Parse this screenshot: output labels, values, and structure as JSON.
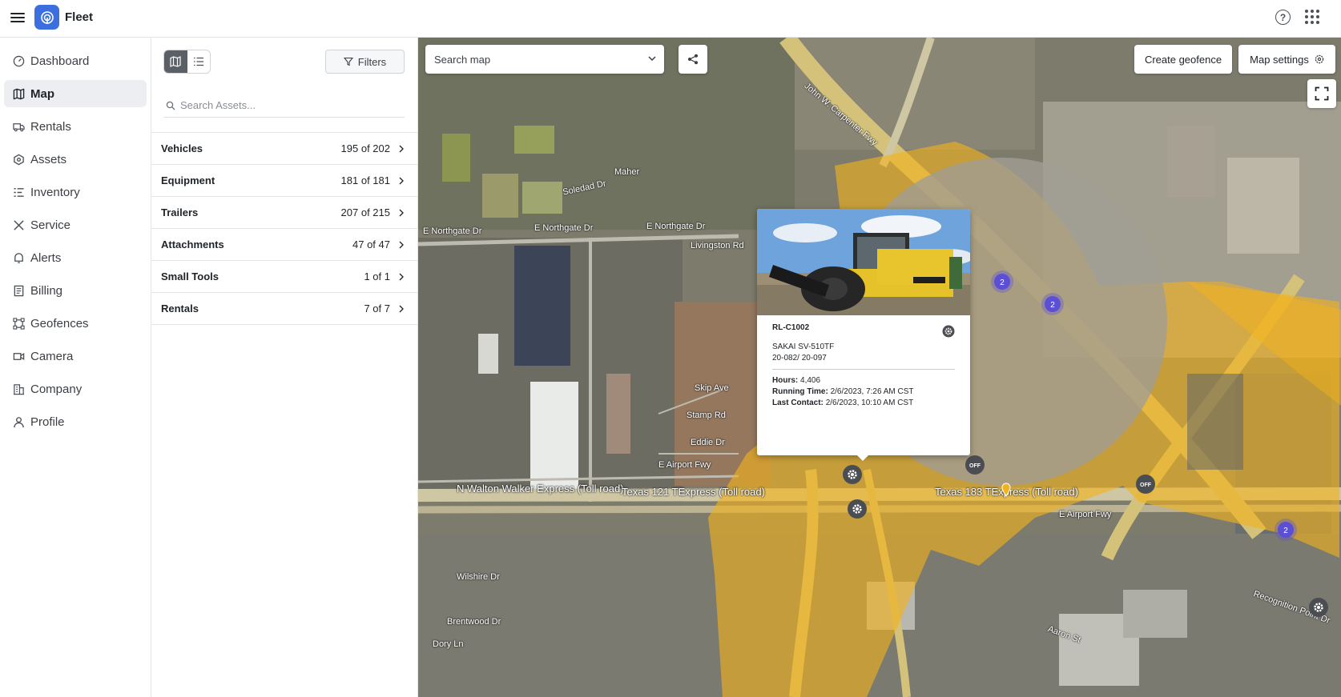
{
  "app": {
    "title": "Fleet",
    "menu_icon": "hamburger-menu-icon",
    "logo_icon": "fleet-logo-icon",
    "help_icon": "help-circle-icon",
    "apps_icon": "apps-grid-icon",
    "accent_color": "#3b6fe0"
  },
  "nav": {
    "items": [
      {
        "label": "Dashboard",
        "icon": "dashboard-icon"
      },
      {
        "label": "Map",
        "icon": "map-icon",
        "active": true
      },
      {
        "label": "Rentals",
        "icon": "truck-icon"
      },
      {
        "label": "Assets",
        "icon": "hexagon-icon"
      },
      {
        "label": "Inventory",
        "icon": "list-icon"
      },
      {
        "label": "Service",
        "icon": "wrench-icon"
      },
      {
        "label": "Alerts",
        "icon": "bell-icon"
      },
      {
        "label": "Billing",
        "icon": "invoice-icon"
      },
      {
        "label": "Geofences",
        "icon": "geofence-icon"
      },
      {
        "label": "Camera",
        "icon": "camera-icon"
      },
      {
        "label": "Company",
        "icon": "building-icon"
      },
      {
        "label": "Profile",
        "icon": "user-icon"
      }
    ]
  },
  "panel": {
    "filters_label": "Filters",
    "search_placeholder": "Search Assets...",
    "categories": [
      {
        "name": "Vehicles",
        "count": "195 of 202"
      },
      {
        "name": "Equipment",
        "count": "181 of 181"
      },
      {
        "name": "Trailers",
        "count": "207 of 215"
      },
      {
        "name": "Attachments",
        "count": "47 of 47"
      },
      {
        "name": "Small Tools",
        "count": "1 of 1"
      },
      {
        "name": "Rentals",
        "count": "7 of 7"
      }
    ]
  },
  "map": {
    "search_placeholder": "Search map",
    "create_geofence_label": "Create geofence",
    "map_settings_label": "Map settings",
    "geofence_color": "#f2b21c",
    "cluster_color": "#5b4fd6",
    "clusters": [
      "2",
      "2",
      "2"
    ],
    "off_badge": "OFF",
    "labels": {
      "walton_walker": "N Walton Walker Express (Toll road)",
      "tx121": "Texas 121 TExpress (Toll road)",
      "tx183": "Texas 183 TExpress (Toll road)",
      "e_airport": "E Airport Fwy",
      "e_airport2": "E Airport Fwy",
      "northgate1": "E Northgate Dr",
      "northgate2": "E Northgate Dr",
      "northgate3": "E Northgate Dr",
      "carpenter": "John W. Carpenter Fwy",
      "maher": "Maher",
      "soledad": "Soledad Dr",
      "livingston": "Livingston Rd",
      "skip": "Skip Ave",
      "stamp": "Stamp Rd",
      "eddie": "Eddie Dr",
      "wilshire": "Wilshire Dr",
      "brentwood": "Brentwood Dr",
      "dory": "Dory Ln",
      "recognition": "Recognition Point Dr",
      "aaron": "Aaron St"
    }
  },
  "popup": {
    "asset_id": "RL-C1002",
    "model": "SAKAI SV-510TF",
    "serial": "20-082/ 20-097",
    "hours_label": "Hours:",
    "hours_value": "4,406",
    "running_label": "Running Time:",
    "running_value": "2/6/2023, 7:26 AM CST",
    "contact_label": "Last Contact:",
    "contact_value": "2/6/2023, 10:10 AM CST"
  }
}
